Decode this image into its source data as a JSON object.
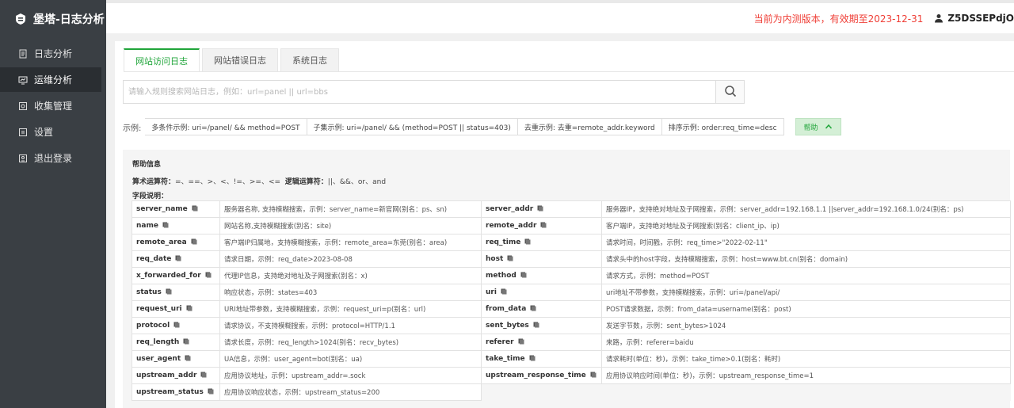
{
  "brand": {
    "title": "堡塔-日志分析"
  },
  "sidebar": {
    "items": [
      {
        "label": "日志分析",
        "icon": "file-icon",
        "active": false
      },
      {
        "label": "运维分析",
        "icon": "monitor-icon",
        "active": true
      },
      {
        "label": "收集管理",
        "icon": "settings-icon",
        "active": false
      },
      {
        "label": "设置",
        "icon": "gear-icon",
        "active": false
      },
      {
        "label": "退出登录",
        "icon": "logout-icon",
        "active": false
      }
    ]
  },
  "topbar": {
    "notice": "当前为内测版本，有效期至2023-12-31",
    "username": "Z5DSSEPdjO"
  },
  "tabs": [
    {
      "label": "网站访问日志",
      "active": true
    },
    {
      "label": "网站错误日志",
      "active": false
    },
    {
      "label": "系统日志",
      "active": false
    }
  ],
  "search": {
    "value": "",
    "placeholder": "请输入规则搜索网站日志，例如：url=panel || url=bbs"
  },
  "examples": {
    "label": "示例:",
    "items": [
      "多条件示例: uri=/panel/ && method=POST",
      "子集示例: uri=/panel/ && (method=POST || status=403)",
      "去重示例: 去重=remote_addr.keyword",
      "排序示例: order:req_time=desc"
    ],
    "help_label": "帮助"
  },
  "help": {
    "title": "帮助信息",
    "ops_label": "算术运算符：",
    "ops_values": "=、==、>、<、!=、>=、<=",
    "logic_label": "逻辑运算符：",
    "logic_values": "||、&&、or、and",
    "fields_title": "字段说明："
  },
  "fields": [
    {
      "lkey": "server_name",
      "ldesc": "服务器名称, 支持模糊搜索，示例：server_name=新官网(别名：ps、sn)",
      "rkey": "server_addr",
      "rdesc": "服务器IP，支持绝对地址及子网搜索，示例：server_addr=192.168.1.1 ||server_addr=192.168.1.0/24(别名：ps)"
    },
    {
      "lkey": "name",
      "ldesc": "网站名称,支持模糊搜索(别名：site)",
      "rkey": "remote_addr",
      "rdesc": "客户端IP，支持绝对地址及子网搜索(别名：client_ip、ip)"
    },
    {
      "lkey": "remote_area",
      "ldesc": "客户端IP归属地，支持模糊搜索，示例：remote_area=东莞(别名：area)",
      "rkey": "req_time",
      "rdesc": "请求时间，时间戳，示例：req_time>\"2022-02-11\""
    },
    {
      "lkey": "req_date",
      "ldesc": "请求日期，示例：req_date>2023-08-08",
      "rkey": "host",
      "rdesc": "请求头中的host字段，支持模糊搜索，示例：host=www.bt.cn(别名：domain)"
    },
    {
      "lkey": "x_forwarded_for",
      "ldesc": "代理IP信息，支持绝对地址及子网搜索(别名：x)",
      "rkey": "method",
      "rdesc": "请求方式，示例：method=POST"
    },
    {
      "lkey": "status",
      "ldesc": "响应状态，示例：states=403",
      "rkey": "uri",
      "rdesc": "uri地址不带参数，支持模糊搜索，示例：uri=/panel/api/"
    },
    {
      "lkey": "request_uri",
      "ldesc": "URI地址带参数，支持模糊搜索，示例：request_uri=p(别名：url)",
      "rkey": "from_data",
      "rdesc": "POST请求数据，示例：from_data=username(别名：post)"
    },
    {
      "lkey": "protocol",
      "ldesc": "请求协议，不支持模糊搜索，示例：protocol=HTTP/1.1",
      "rkey": "sent_bytes",
      "rdesc": "发送字节数，示例：sent_bytes>1024"
    },
    {
      "lkey": "req_length",
      "ldesc": "请求长度，示例：req_length>1024(别名：recv_bytes)",
      "rkey": "referer",
      "rdesc": "来路，示例：referer=baidu"
    },
    {
      "lkey": "user_agent",
      "ldesc": "UA信息，示例：user_agent=bot(别名：ua)",
      "rkey": "take_time",
      "rdesc": "请求耗时(单位：秒)，示例：take_time>0.1(别名：耗时)"
    },
    {
      "lkey": "upstream_addr",
      "ldesc": "应用协议地址，示例：upstream_addr=.sock",
      "rkey": "upstream_response_time",
      "rdesc": "应用协议响应时间(单位：秒)，示例：upstream_response_time=1"
    },
    {
      "lkey": "upstream_status",
      "ldesc": "应用协议响应状态，示例：upstream_status=200",
      "rkey": "",
      "rdesc": ""
    }
  ],
  "colors": {
    "accent": "#20a53a",
    "sidebar": "#3a3f44",
    "notice": "#ef3e36"
  }
}
